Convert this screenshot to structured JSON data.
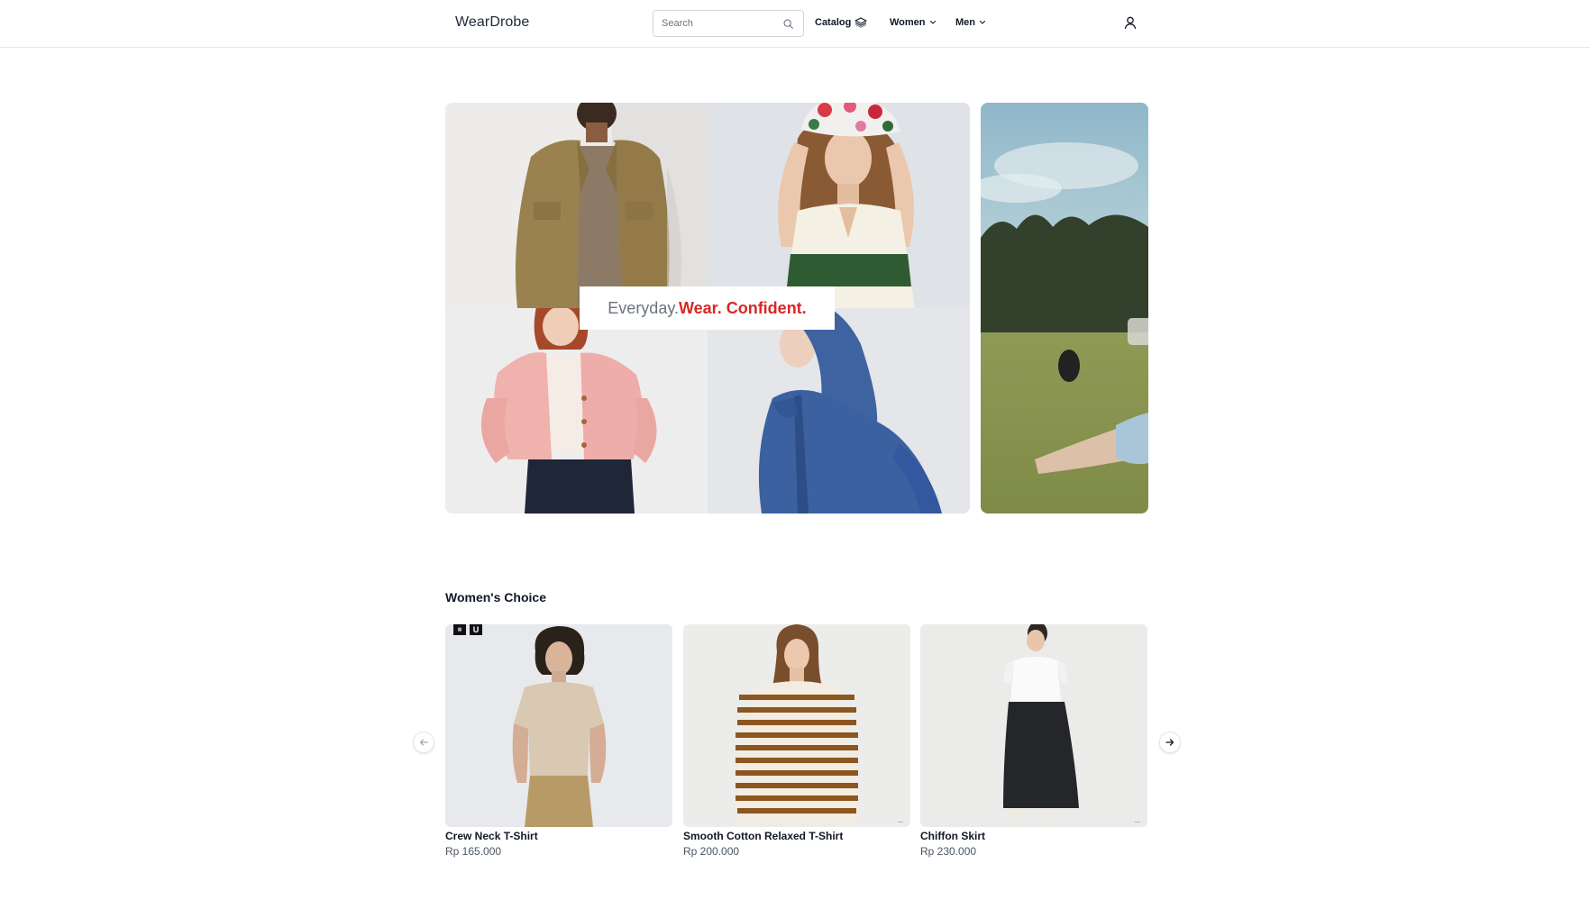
{
  "header": {
    "logo": "WearDrobe",
    "search": {
      "placeholder": "Search",
      "value": ""
    },
    "nav": [
      {
        "label": "Catalog",
        "icon": "layers-icon"
      },
      {
        "label": "Women",
        "icon": "chevron-down-icon"
      },
      {
        "label": "Men",
        "icon": "chevron-down-icon"
      }
    ],
    "user_icon": "user-icon"
  },
  "hero": {
    "tagline_light": "Everyday.",
    "tagline_bold": "Wear. Confident.",
    "accent_color": "#dc2626",
    "tiles": [
      {
        "name": "olive-shirt-jacket-photo"
      },
      {
        "name": "bucket-hat-striped-top-photo"
      },
      {
        "name": "pink-cardigan-photo"
      },
      {
        "name": "blue-hooded-parka-photo"
      }
    ],
    "side_slide": "meadow-slide-photo"
  },
  "womens_choice": {
    "title": "Women's Choice",
    "products": [
      {
        "name": "Crew Neck T-Shirt",
        "price": "Rp 165.000"
      },
      {
        "name": "Smooth Cotton Relaxed T-Shirt",
        "price": "Rp 200.000"
      },
      {
        "name": "Chiffon Skirt",
        "price": "Rp 230.000"
      }
    ],
    "prev_icon": "arrow-left-icon",
    "next_icon": "arrow-right-icon"
  }
}
